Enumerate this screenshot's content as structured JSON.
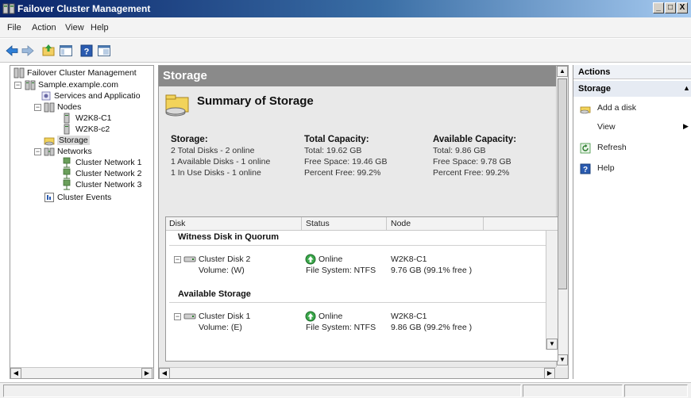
{
  "window": {
    "title": "Failover Cluster Management",
    "controls": [
      "_",
      "□",
      "X"
    ]
  },
  "menu": [
    "File",
    "Action",
    "View",
    "Help"
  ],
  "toolbar": [
    "back-icon",
    "forward-icon",
    "up-folder-icon",
    "show-hide-tree-icon",
    "help-icon",
    "properties-icon"
  ],
  "tree": {
    "root": "Failover Cluster Management",
    "cluster": "Sample.example.com",
    "services": "Services and Applicatio",
    "nodes": "Nodes",
    "node1": "W2K8-C1",
    "node2": "W2K8-c2",
    "storage": "Storage",
    "networks": "Networks",
    "net1": "Cluster Network 1",
    "net2": "Cluster Network 2",
    "net3": "Cluster Network 3",
    "events": "Cluster Events"
  },
  "center": {
    "header": "Storage",
    "summary_title": "Summary of Storage",
    "storage": {
      "heading": "Storage:",
      "lines": [
        "2 Total Disks - 2 online",
        "1 Available Disks - 1 online",
        "1 In Use Disks - 1 online"
      ]
    },
    "total": {
      "heading": "Total Capacity:",
      "lines": [
        "Total: 19.62 GB",
        "Free Space: 19.46 GB",
        "Percent Free: 99.2%"
      ]
    },
    "available": {
      "heading": "Available Capacity:",
      "lines": [
        "Total: 9.86 GB",
        "Free Space: 9.78 GB",
        "Percent Free: 99.2%"
      ]
    },
    "table": {
      "columns": [
        "Disk",
        "Status",
        "Node"
      ],
      "groups": [
        {
          "name": "Witness Disk in Quorum",
          "disk": "Cluster Disk 2",
          "volume": "Volume: (W)",
          "status": "Online",
          "fs": "File System: NTFS",
          "node": "W2K8-C1",
          "free": "9.76 GB (99.1% free )"
        },
        {
          "name": "Available Storage",
          "disk": "Cluster Disk 1",
          "volume": "Volume: (E)",
          "status": "Online",
          "fs": "File System: NTFS",
          "node": "W2K8-C1",
          "free": "9.86 GB (99.2% free )"
        }
      ]
    }
  },
  "actions": {
    "header": "Actions",
    "section": "Storage",
    "items": [
      "Add a disk",
      "View",
      "Refresh",
      "Help"
    ]
  }
}
